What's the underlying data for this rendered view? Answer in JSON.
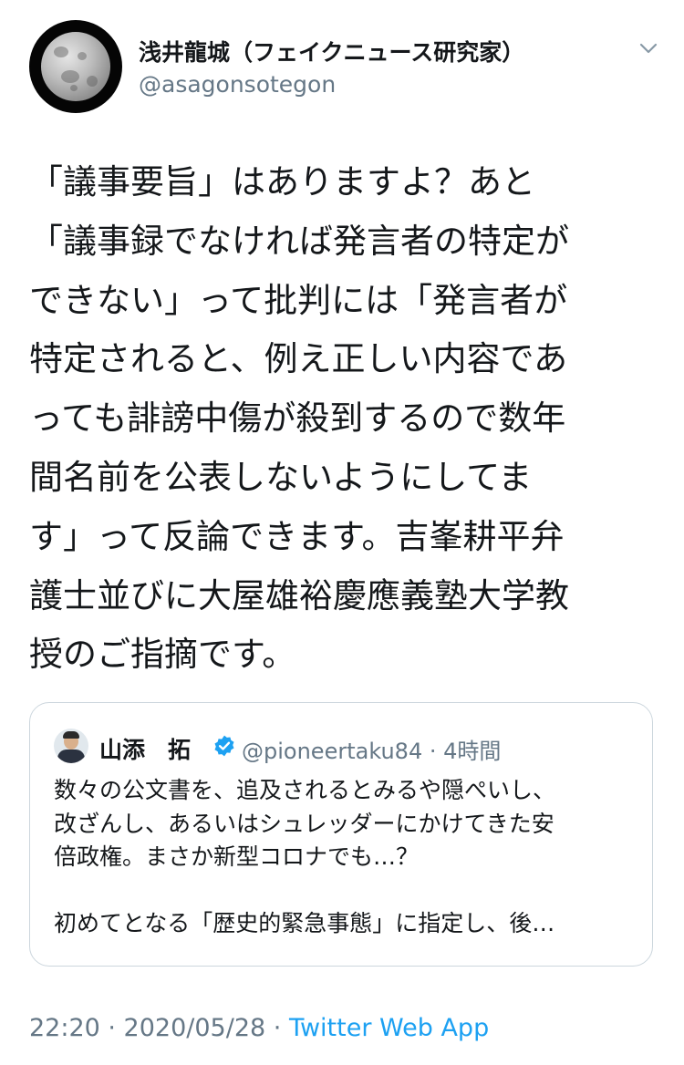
{
  "author": {
    "name": "浅井龍城（フェイクニュース研究家）",
    "handle": "@asagonsotegon"
  },
  "tweet": {
    "lines": [
      "「議事要旨」はありますよ？あと",
      "「議事録でなければ発言者の特定が",
      "できない」って批判には「発言者が",
      "特定されると、例え正しい内容であ",
      "っても誹謗中傷が殺到するので数年",
      "間名前を公表しないようにしてま",
      "す」って反論できます。吉峯耕平弁",
      "護士並びに大屋雄裕慶應義塾大学教",
      "授のご指摘です。"
    ]
  },
  "quote": {
    "name": "山添　拓",
    "handle_time": "@pioneertaku84 · 4時間",
    "lines": [
      "数々の公文書を、追及されるとみるや隠ぺいし、",
      "改ざんし、あるいはシュレッダーにかけてきた安",
      "倍政権。まさか新型コロナでも…？",
      "",
      "初めてとなる「歴史的緊急事態」に指定し、後…"
    ]
  },
  "meta": {
    "timestamp": "22:20 · 2020/05/28 · ",
    "source": "Twitter Web App"
  },
  "icons": {
    "menu": "chevron-down-icon",
    "verified": "verified-badge-icon"
  },
  "colors": {
    "text": "#14171a",
    "secondary": "#657786",
    "link": "#1da1f2",
    "border": "#ccd6dd"
  }
}
